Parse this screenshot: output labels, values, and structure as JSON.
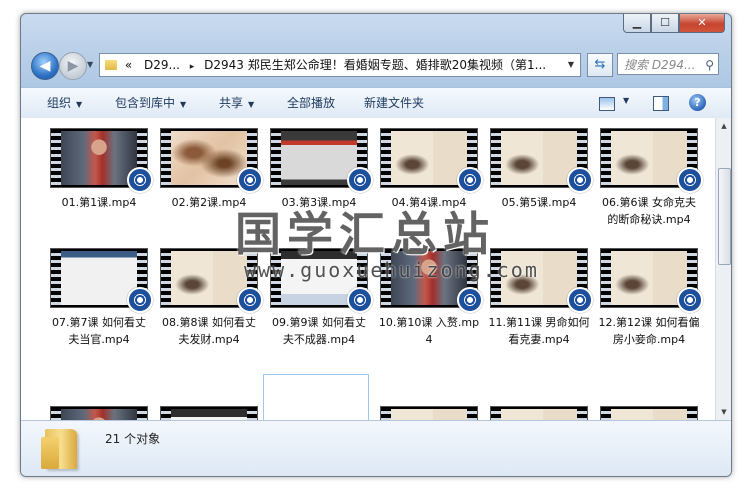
{
  "window": {
    "controls": {
      "minimize": "▁",
      "maximize": "☐",
      "close": "✕"
    }
  },
  "nav": {
    "back": "◀",
    "forward": "▶",
    "address": {
      "prefix": "«",
      "crumb1": "D29...",
      "crumb2": "D2943 郑民生郑公命理！看婚姻专题、婚排歌20集视频（第1...",
      "separator": "▸"
    },
    "search_placeholder": "搜索 D294..."
  },
  "toolbar": {
    "organize": "组织",
    "include_in_library": "包含到库中",
    "share": "共享",
    "play_all": "全部播放",
    "new_folder": "新建文件夹"
  },
  "files": [
    {
      "name": "01.第1课.mp4",
      "thumb": "woman"
    },
    {
      "name": "02.第2课.mp4",
      "thumb": "marble"
    },
    {
      "name": "03.第3课.mp4",
      "thumb": "dark"
    },
    {
      "name": "04.第4课.mp4",
      "thumb": "book"
    },
    {
      "name": "05.第5课.mp4",
      "thumb": "book"
    },
    {
      "name": "06.第6课 女命克夫的断命秘诀.mp4",
      "thumb": "book"
    },
    {
      "name": "07.第7课 如何看丈夫当官.mp4",
      "thumb": "screen"
    },
    {
      "name": "08.第8课 如何看丈夫发财.mp4",
      "thumb": "book"
    },
    {
      "name": "09.第9课 如何看丈夫不成器.mp4",
      "thumb": "screen2"
    },
    {
      "name": "10.第10课 入赘.mp4",
      "thumb": "woman"
    },
    {
      "name": "11.第11课 男命如何看克妻.mp4",
      "thumb": "book"
    },
    {
      "name": "12.第12课 如何看偏房小妾命.mp4",
      "thumb": "book"
    }
  ],
  "status": {
    "count": "21 个对象"
  },
  "watermark": {
    "cn": "国学汇总站",
    "url": "www.guoxuehuizong.com"
  },
  "colors": {
    "accent": "#1c4f9c",
    "toolbar_text": "#1e3a5f"
  }
}
